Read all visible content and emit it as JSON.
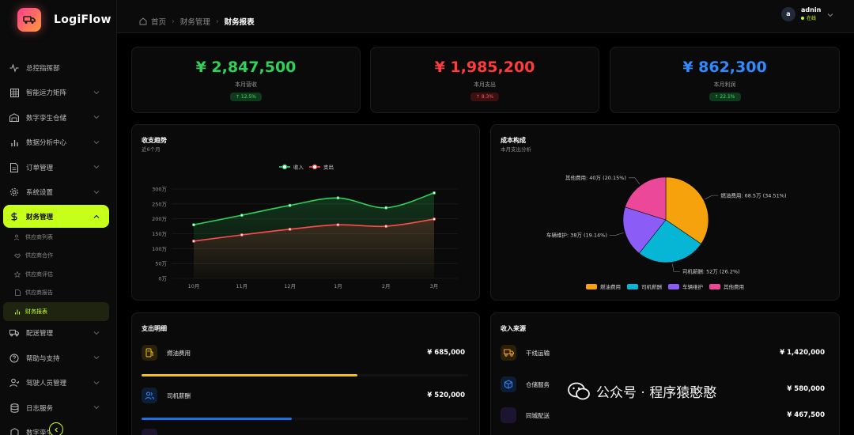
{
  "app": {
    "name": "LogiFlow"
  },
  "sidebar": {
    "items": [
      {
        "label": "总控指挥部",
        "icon": "pulse-icon",
        "chevron": false
      },
      {
        "label": "智能运力矩阵",
        "icon": "grid-icon",
        "chevron": true
      },
      {
        "label": "数字孪生仓储",
        "icon": "warehouse-icon",
        "chevron": true
      },
      {
        "label": "数据分析中心",
        "icon": "bar-chart-icon",
        "chevron": true
      },
      {
        "label": "订单管理",
        "icon": "document-icon",
        "chevron": true
      },
      {
        "label": "系统设置",
        "icon": "gear-icon",
        "chevron": true
      }
    ],
    "active": {
      "label": "财务管理",
      "icon": "dollar-icon"
    },
    "sub_items": [
      {
        "label": "供应商列表",
        "icon": "users-icon"
      },
      {
        "label": "供应商合作",
        "icon": "handshake-icon"
      },
      {
        "label": "供应商评估",
        "icon": "star-icon"
      },
      {
        "label": "供应商报告",
        "icon": "file-icon"
      },
      {
        "label": "财务报表",
        "icon": "bar-chart-icon",
        "active": true
      }
    ],
    "items_after": [
      {
        "label": "配送管理",
        "icon": "truck-icon",
        "chevron": true
      },
      {
        "label": "帮助与支持",
        "icon": "help-icon",
        "chevron": true
      },
      {
        "label": "驾驶人员管理",
        "icon": "driver-icon",
        "chevron": true
      },
      {
        "label": "日志服务",
        "icon": "database-icon",
        "chevron": true
      },
      {
        "label": "数字孪生",
        "icon": "cube-icon",
        "chevron": false
      }
    ]
  },
  "header": {
    "breadcrumb": [
      "首页",
      "财务管理",
      "财务报表"
    ],
    "user": {
      "name": "adnin",
      "initial": "a",
      "status": "在线"
    }
  },
  "kpis": [
    {
      "value": "¥ 2,847,500",
      "label": "本月营收",
      "badge": "↑ 12.5%",
      "color": "#2fd15b",
      "badge_bg": "#0f3a1b",
      "badge_color": "#3fe06a"
    },
    {
      "value": "¥ 1,985,200",
      "label": "本月支出",
      "badge": "↑ 8.3%",
      "color": "#ff3b3b",
      "badge_bg": "#3a1010",
      "badge_color": "#ff5a5a"
    },
    {
      "value": "¥ 862,300",
      "label": "本月利润",
      "badge": "↑ 22.1%",
      "color": "#2f8bff",
      "badge_bg": "#0f3a1b",
      "badge_color": "#3fe06a"
    }
  ],
  "trend": {
    "title": "收支趋势",
    "subtitle": "近6个月",
    "chart_data": {
      "type": "area",
      "categories": [
        "10月",
        "11月",
        "12月",
        "1月",
        "2月",
        "3月"
      ],
      "series": [
        {
          "name": "收入",
          "values": [
            180,
            212,
            245,
            270,
            237,
            287
          ],
          "color": "#2fd15b"
        },
        {
          "name": "支出",
          "values": [
            125,
            146,
            165,
            180,
            175,
            199
          ],
          "color": "#ff4d4d"
        }
      ],
      "yticks": [
        "300万",
        "250万",
        "200万",
        "150万",
        "100万",
        "50万",
        "0万"
      ],
      "ylim": [
        0,
        300
      ]
    }
  },
  "composition": {
    "title": "成本构成",
    "subtitle": "本月支出分析",
    "chart_data": {
      "type": "pie",
      "slices": [
        {
          "name": "燃油费用",
          "value": 68.5,
          "label": "燃油费用: 68.5万 (34.51%)",
          "color": "#f5a20c"
        },
        {
          "name": "司机薪酬",
          "value": 52,
          "label": "司机薪酬: 52万 (26.2%)",
          "color": "#06b6d4"
        },
        {
          "name": "车辆维护",
          "value": 38,
          "label": "车辆维护: 38万 (19.14%)",
          "color": "#8b5cf6"
        },
        {
          "name": "其他费用",
          "value": 40,
          "label": "其他费用: 40万 (20.15%)",
          "color": "#ec4899"
        }
      ]
    }
  },
  "expenses": {
    "title": "支出明细",
    "items": [
      {
        "name": "燃油费用",
        "amount": "¥ 685,000",
        "icon": "fuel-icon",
        "color": "#f5c20c",
        "icon_bg": "#2a2208",
        "progress": 0.66
      },
      {
        "name": "司机薪酬",
        "amount": "¥ 520,000",
        "icon": "users-icon",
        "color": "#1e6fe8",
        "icon_bg": "#0d1d33",
        "progress": 0.46
      }
    ]
  },
  "income": {
    "title": "收入来源",
    "items": [
      {
        "name": "干线运输",
        "amount": "¥ 1,420,000",
        "icon": "truck-icon",
        "color": "#f5a20c",
        "icon_bg": "#2a1f08"
      },
      {
        "name": "仓储服务",
        "amount": "¥ 580,000",
        "icon": "box-icon",
        "color": "#2f8bff",
        "icon_bg": "#0d1d33"
      },
      {
        "name": "同城配送",
        "amount": "¥ 467,500",
        "icon": "bolt-icon",
        "color": "#8b5cf6",
        "icon_bg": "#1d1530"
      }
    ]
  },
  "watermark": {
    "text": "公众号 · 程序猿憨憨"
  }
}
